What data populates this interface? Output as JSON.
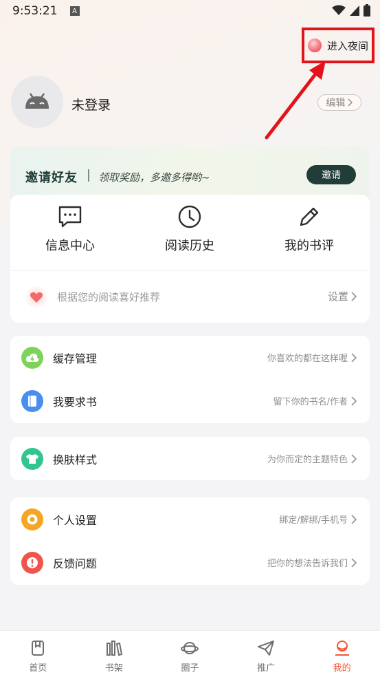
{
  "status_bar": {
    "time": "9:53:21",
    "notif_letter": "A"
  },
  "header": {
    "night_mode_label": "进入夜间",
    "username": "未登录",
    "edit_label": "编辑"
  },
  "invite": {
    "title": "邀请好友",
    "subtitle": "领取奖励，多邀多得哟~",
    "button": "邀请"
  },
  "quick_actions": [
    {
      "label": "信息中心",
      "icon": "message-icon"
    },
    {
      "label": "阅读历史",
      "icon": "clock-icon"
    },
    {
      "label": "我的书评",
      "icon": "pen-icon"
    }
  ],
  "recommend": {
    "text": "根据您的阅读喜好推荐",
    "action": "设置"
  },
  "group1": [
    {
      "label": "缓存管理",
      "hint": "你喜欢的都在这样喔",
      "icon": "cloud-download-icon",
      "color": "#7ed35a"
    },
    {
      "label": "我要求书",
      "hint": "留下你的书名/作者",
      "icon": "book-icon",
      "color": "#4a8ff0"
    }
  ],
  "group2": [
    {
      "label": "换肤样式",
      "hint": "为你而定的主题特色",
      "icon": "shirt-icon",
      "color": "#33c58e"
    }
  ],
  "group3": [
    {
      "label": "个人设置",
      "hint": "绑定/解绑/手机号",
      "icon": "settings-icon",
      "color": "#f5a623"
    },
    {
      "label": "反馈问题",
      "hint": "把你的想法告诉我们",
      "icon": "alert-icon",
      "color": "#f0554d"
    }
  ],
  "tabbar": [
    {
      "label": "首页",
      "icon": "bookmark-icon",
      "active": false
    },
    {
      "label": "书架",
      "icon": "bookshelf-icon",
      "active": false
    },
    {
      "label": "圈子",
      "icon": "planet-icon",
      "active": false
    },
    {
      "label": "推广",
      "icon": "paper-plane-icon",
      "active": false
    },
    {
      "label": "我的",
      "icon": "user-icon",
      "active": true
    }
  ],
  "colors": {
    "accent": "#f35735",
    "highlight_box": "#e2131b",
    "invite_button": "#203d37"
  }
}
